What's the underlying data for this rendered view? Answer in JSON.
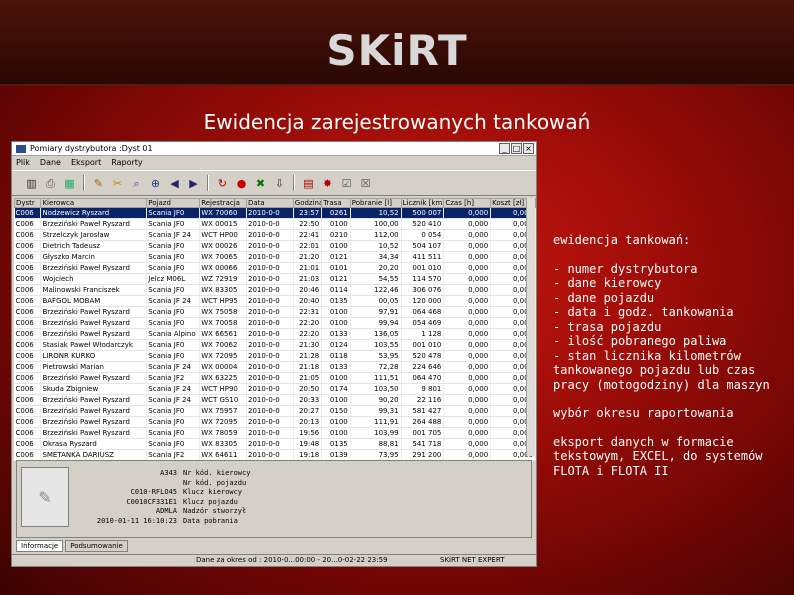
{
  "slide": {
    "brand": "SKiRT",
    "subtitle": "Ewidencja zarejestrowanych tankowań"
  },
  "window": {
    "title": "Pomiary dystrybutora :Dyst 01",
    "menu": [
      "Plik",
      "Dane",
      "Eksport",
      "Raporty"
    ],
    "toolbar_icons": [
      "filter-icon",
      "print-icon",
      "calendar-icon",
      "edit-icon",
      "tools-icon",
      "find-icon",
      "zoom-icon",
      "prev-icon",
      "next-icon",
      "refresh-icon",
      "stop-icon",
      "excel-icon",
      "export-icon",
      "report-icon",
      "settings-icon",
      "select-icon",
      "close-icon"
    ],
    "table": {
      "headers": [
        "Dystr",
        "Kierowca",
        "Pojazd",
        "Rejestracja",
        "Data",
        "Godzina",
        "Trasa",
        "Pobranie [l]",
        "Licznik [km]",
        "Czas [h]",
        "Koszt [zł]"
      ],
      "rows": [
        [
          "C006",
          "Nodzewicz Ryszard",
          "Scania JF0",
          "WX 70060",
          "2010-0-0",
          "23:57",
          "0261",
          "10,52",
          "500 007",
          "0,000",
          "0,000"
        ],
        [
          "C006",
          "Brzeziński Paweł Ryszard",
          "Scania JF0",
          "WX 00015",
          "2010-0-0",
          "22:50",
          "0100",
          "100,00",
          "520 410",
          "0,000",
          "0,000"
        ],
        [
          "C006",
          "Strzelczyk Jarosław",
          "Scania JF 24",
          "WCT HP00",
          "2010-0-0",
          "22:41",
          "0210",
          "112,00",
          "0 054",
          "0,000",
          "0,000"
        ],
        [
          "C006",
          "Dietrich Tadeusz",
          "Scania JF0",
          "WX 00026",
          "2010-0-0",
          "22:01",
          "0100",
          "10,52",
          "504 107",
          "0,000",
          "0,000"
        ],
        [
          "C006",
          "Głyszko Marcin",
          "Scania JF0",
          "WX 70065",
          "2010-0-0",
          "21:20",
          "0121",
          "34,34",
          "411 511",
          "0,000",
          "0,000"
        ],
        [
          "C006",
          "Brzeziński Paweł Ryszard",
          "Scania JF0",
          "WX 00066",
          "2010-0-0",
          "21:01",
          "0101",
          "20,20",
          "001 010",
          "0,000",
          "0,000"
        ],
        [
          "C006",
          "Wojciech",
          "Jelcz M06L",
          "WZ 72919",
          "2010-0-0",
          "21:03",
          "0121",
          "54,55",
          "114 570",
          "0,000",
          "0,000"
        ],
        [
          "C006",
          "Malinowski Franciszek",
          "Scania JF0",
          "WX 83305",
          "2010-0-0",
          "20:46",
          "0114",
          "122,46",
          "306 076",
          "0,000",
          "0,000"
        ],
        [
          "C006",
          "BAFGOL MOBAM",
          "Scania JF 24",
          "WCT HP95",
          "2010-0-0",
          "20:40",
          "0135",
          "00,05",
          "120 000",
          "0,000",
          "0,000"
        ],
        [
          "C006",
          "Brzeziński Paweł Ryszard",
          "Scania JF0",
          "WX 75058",
          "2010-0-0",
          "22:31",
          "0100",
          "97,91",
          "064 468",
          "0,000",
          "0,000"
        ],
        [
          "C006",
          "Brzeziński Paweł Ryszard",
          "Scania JF0",
          "WX 70058",
          "2010-0-0",
          "22:20",
          "0100",
          "99,94",
          "054 469",
          "0,000",
          "0,000"
        ],
        [
          "C006",
          "Brzeziński Paweł Ryszard",
          "Scania Alpino",
          "WX 66561",
          "2010-0-0",
          "22:20",
          "0133",
          "136,05",
          "1 128",
          "0,000",
          "0,000"
        ],
        [
          "C006",
          "Stasiak Paweł Włodarczyk",
          "Scania JF0",
          "WX 70062",
          "2010-0-0",
          "21:30",
          "0124",
          "103,55",
          "001 010",
          "0,000",
          "0,000"
        ],
        [
          "C006",
          "LIRONR KURKO",
          "Scania JF0",
          "WX 72095",
          "2010-0-0",
          "21:28",
          "0118",
          "53,95",
          "520 478",
          "0,000",
          "0,000"
        ],
        [
          "C006",
          "Pietrowski Marian",
          "Scania JF 24",
          "WX 00004",
          "2010-0-0",
          "21:18",
          "0133",
          "72,28",
          "224 646",
          "0,000",
          "0,000"
        ],
        [
          "C006",
          "Brzeziński Paweł Ryszard",
          "Scania JF2",
          "WX 63225",
          "2010-0-0",
          "21:05",
          "0100",
          "111,51",
          "064 470",
          "0,000",
          "0,000"
        ],
        [
          "C006",
          "Skuda Zbigniew",
          "Scania JF 24",
          "WCT HP90",
          "2010-0-0",
          "20:50",
          "0174",
          "103,50",
          "9 801",
          "0,000",
          "0,000"
        ],
        [
          "C006",
          "Brzeziński Paweł Ryszard",
          "Scania JF 24",
          "WCT GS10",
          "2010-0-0",
          "20:33",
          "0100",
          "90,20",
          "22 116",
          "0,000",
          "0,000"
        ],
        [
          "C006",
          "Brzeziński Paweł Ryszard",
          "Scania JF0",
          "WX 75957",
          "2010-0-0",
          "20:27",
          "0150",
          "99,31",
          "581 427",
          "0,000",
          "0,000"
        ],
        [
          "C006",
          "Brzeziński Paweł Ryszard",
          "Scania JF0",
          "WX 72095",
          "2010-0-0",
          "20:13",
          "0100",
          "111,91",
          "264 488",
          "0,000",
          "0,000"
        ],
        [
          "C006",
          "Brzeziński Paweł Ryszard",
          "Scania JF0",
          "WX 78059",
          "2010-0-0",
          "19:56",
          "0100",
          "103,99",
          "001 705",
          "0,000",
          "0,000"
        ],
        [
          "C006",
          "Okrasa Ryszard",
          "Scania JF0",
          "WX 83305",
          "2010-0-0",
          "19:48",
          "0135",
          "88,81",
          "541 718",
          "0,000",
          "0,000"
        ],
        [
          "C006",
          "SMETANKA DARIUSZ",
          "Scania JF2",
          "WX 64611",
          "2010-0-0",
          "19:18",
          "0139",
          "73,95",
          "291 200",
          "0,000",
          "0,000"
        ]
      ]
    },
    "detail": {
      "values": [
        "A343",
        "",
        "C010-RFLO45",
        "C0010CF331E1",
        "ADMLA",
        "2010-01-11 16:10:23"
      ],
      "labels": [
        "Nr kód. kierowcy",
        "Nr kód. pojazdu",
        "Klucz kierowcy",
        "Klucz pojazdu",
        "Nadzór stworzył",
        "Data pobrania"
      ]
    },
    "tabs": [
      "Informacje",
      "Podsumowanie"
    ],
    "status": {
      "range": "Dane za okres od : 2010-0...00:00 - 20...0-02-22 23:59",
      "product": "SKiRT NET EXPERT"
    }
  },
  "notes": {
    "heading": "ewidencja tankowań:",
    "bullets": [
      "- numer dystrybutora",
      "- dane kierowcy",
      "- dane pojazdu",
      "- data i godz. tankowania",
      "- trasa pojazdu",
      "- ilość pobranego paliwa",
      "- stan licznika kilometrów",
      "tankowanego pojazdu lub czas",
      "pracy (motogodziny) dla maszyn"
    ],
    "period": "wybór okresu raportowania",
    "export_lines": [
      "eksport danych w formacie",
      "tekstowym, EXCEL, do systemów",
      "FLOTA i FLOTA II"
    ]
  }
}
